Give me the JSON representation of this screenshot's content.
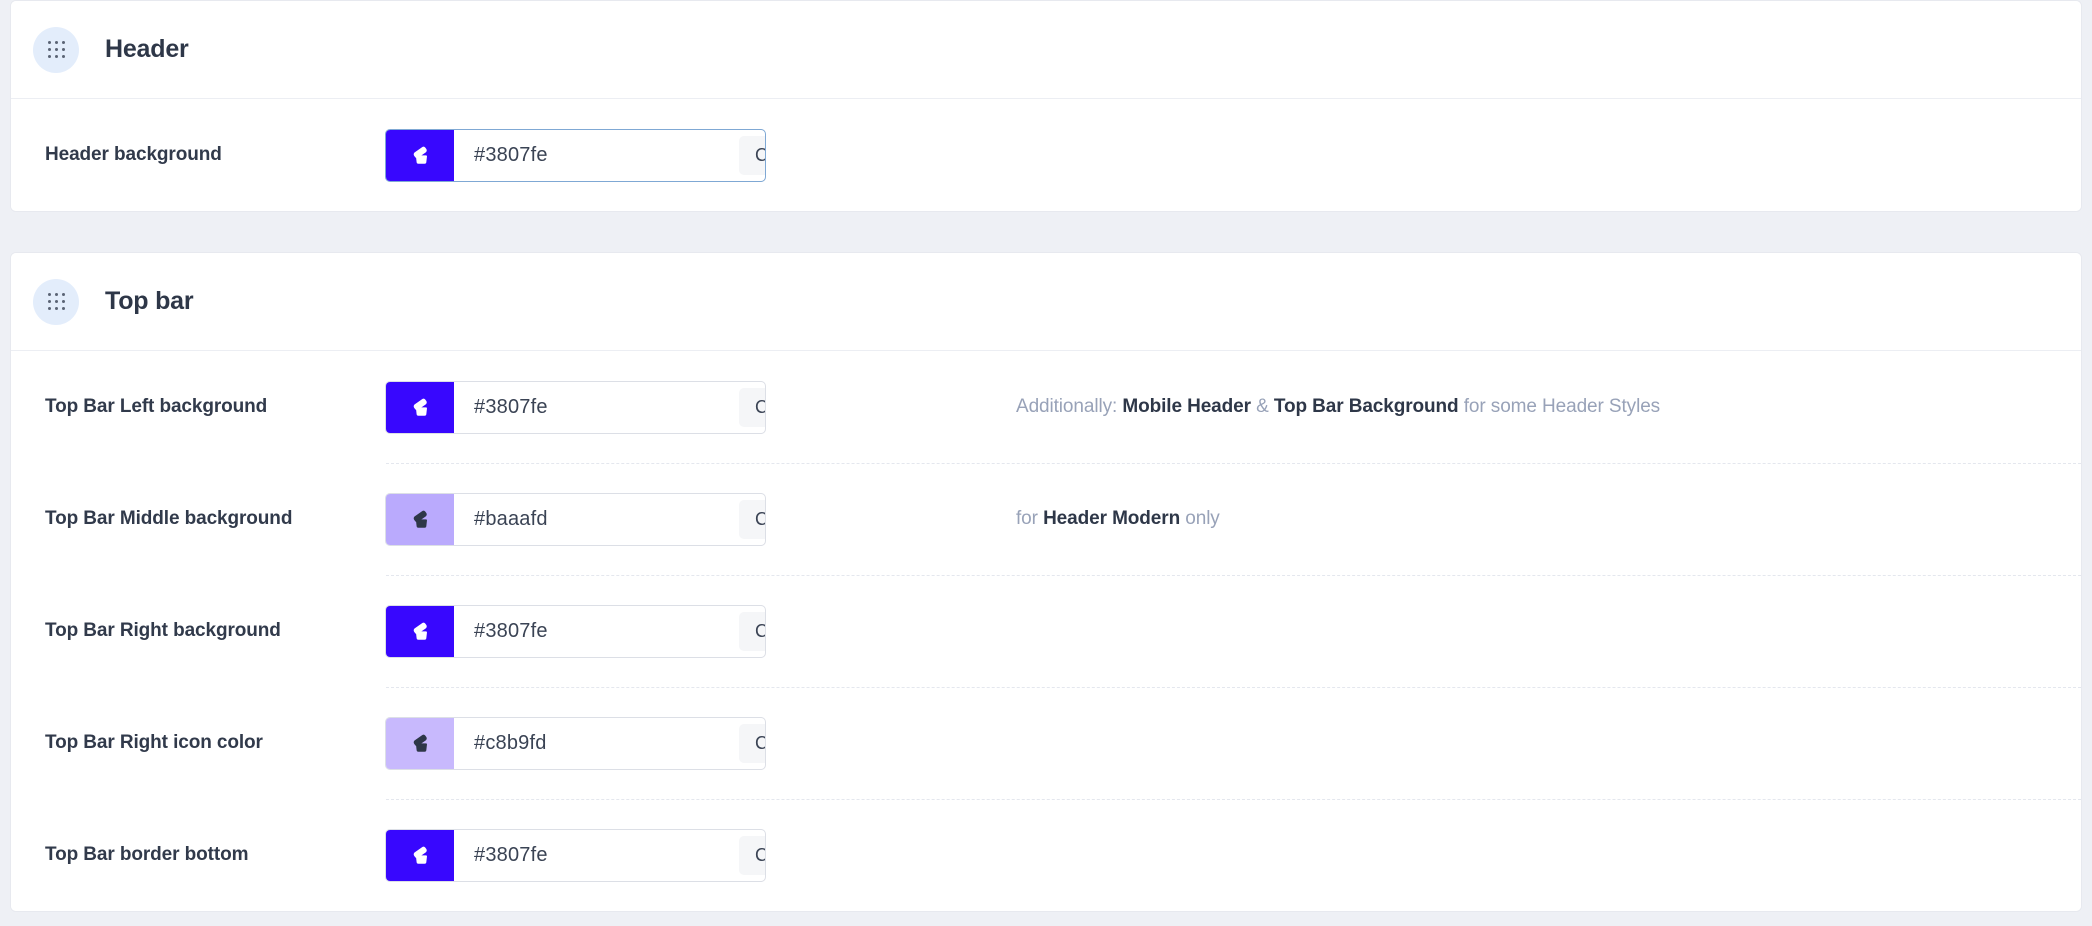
{
  "sections": [
    {
      "id": "header",
      "title": "Header",
      "drag_handle_icon": "drag-dots-icon",
      "rows": [
        {
          "label": "Header background",
          "swatch_color": "#3807fe",
          "swatch_icon": "paint-bucket-icon",
          "swatch_icon_color": "#ffffff",
          "value": "#3807fe",
          "placeholder": "#3807fe",
          "clear_label": "Clear",
          "focused": true,
          "hint": null
        }
      ]
    },
    {
      "id": "top-bar",
      "title": "Top bar",
      "drag_handle_icon": "drag-dots-icon",
      "rows": [
        {
          "label": "Top Bar Left background",
          "swatch_color": "#3807fe",
          "swatch_icon": "paint-bucket-icon",
          "swatch_icon_color": "#ffffff",
          "value": "#3807fe",
          "placeholder": "#3807fe",
          "clear_label": "Clear",
          "focused": false,
          "hint": {
            "parts": [
              {
                "text": "Additionally: ",
                "bold": false
              },
              {
                "text": "Mobile Header",
                "bold": true
              },
              {
                "text": " & ",
                "bold": false
              },
              {
                "text": "Top Bar Background",
                "bold": true
              },
              {
                "text": " for some Header Styles",
                "bold": false
              }
            ]
          }
        },
        {
          "label": "Top Bar Middle background",
          "swatch_color": "#baaafd",
          "swatch_icon": "paint-bucket-icon",
          "swatch_icon_color": "#2e3748",
          "value": "#baaafd",
          "placeholder": "#baaafd",
          "clear_label": "Clear",
          "focused": false,
          "hint": {
            "parts": [
              {
                "text": "for ",
                "bold": false
              },
              {
                "text": "Header Modern",
                "bold": true
              },
              {
                "text": " only",
                "bold": false
              }
            ]
          }
        },
        {
          "label": "Top Bar Right background",
          "swatch_color": "#3807fe",
          "swatch_icon": "paint-bucket-icon",
          "swatch_icon_color": "#ffffff",
          "value": "#3807fe",
          "placeholder": "#3807fe",
          "clear_label": "Clear",
          "focused": false,
          "hint": null
        },
        {
          "label": "Top Bar Right icon color",
          "swatch_color": "#c8b9fd",
          "swatch_icon": "paint-bucket-icon",
          "swatch_icon_color": "#2e3748",
          "value": "#c8b9fd",
          "placeholder": "#c8b9fd",
          "clear_label": "Clear",
          "focused": false,
          "hint": null
        },
        {
          "label": "Top Bar border bottom",
          "swatch_color": "#3807fe",
          "swatch_icon": "paint-bucket-icon",
          "swatch_icon_color": "#ffffff",
          "value": "#3807fe",
          "placeholder": "#3807fe",
          "clear_label": "Clear",
          "focused": false,
          "hint": null
        }
      ]
    }
  ],
  "theme": {
    "page_background": "#eef0f5",
    "card_background": "#ffffff",
    "card_border": "#e7e9ef",
    "label_color": "#313a4b",
    "hint_muted_color": "#98a2b8",
    "hint_strong_color": "#2e3748",
    "drag_circle_background": "#e3edfb",
    "focus_border": "#7fa8d4",
    "input_border": "#dcdfe6",
    "clear_button_background": "#f5f6f8"
  }
}
